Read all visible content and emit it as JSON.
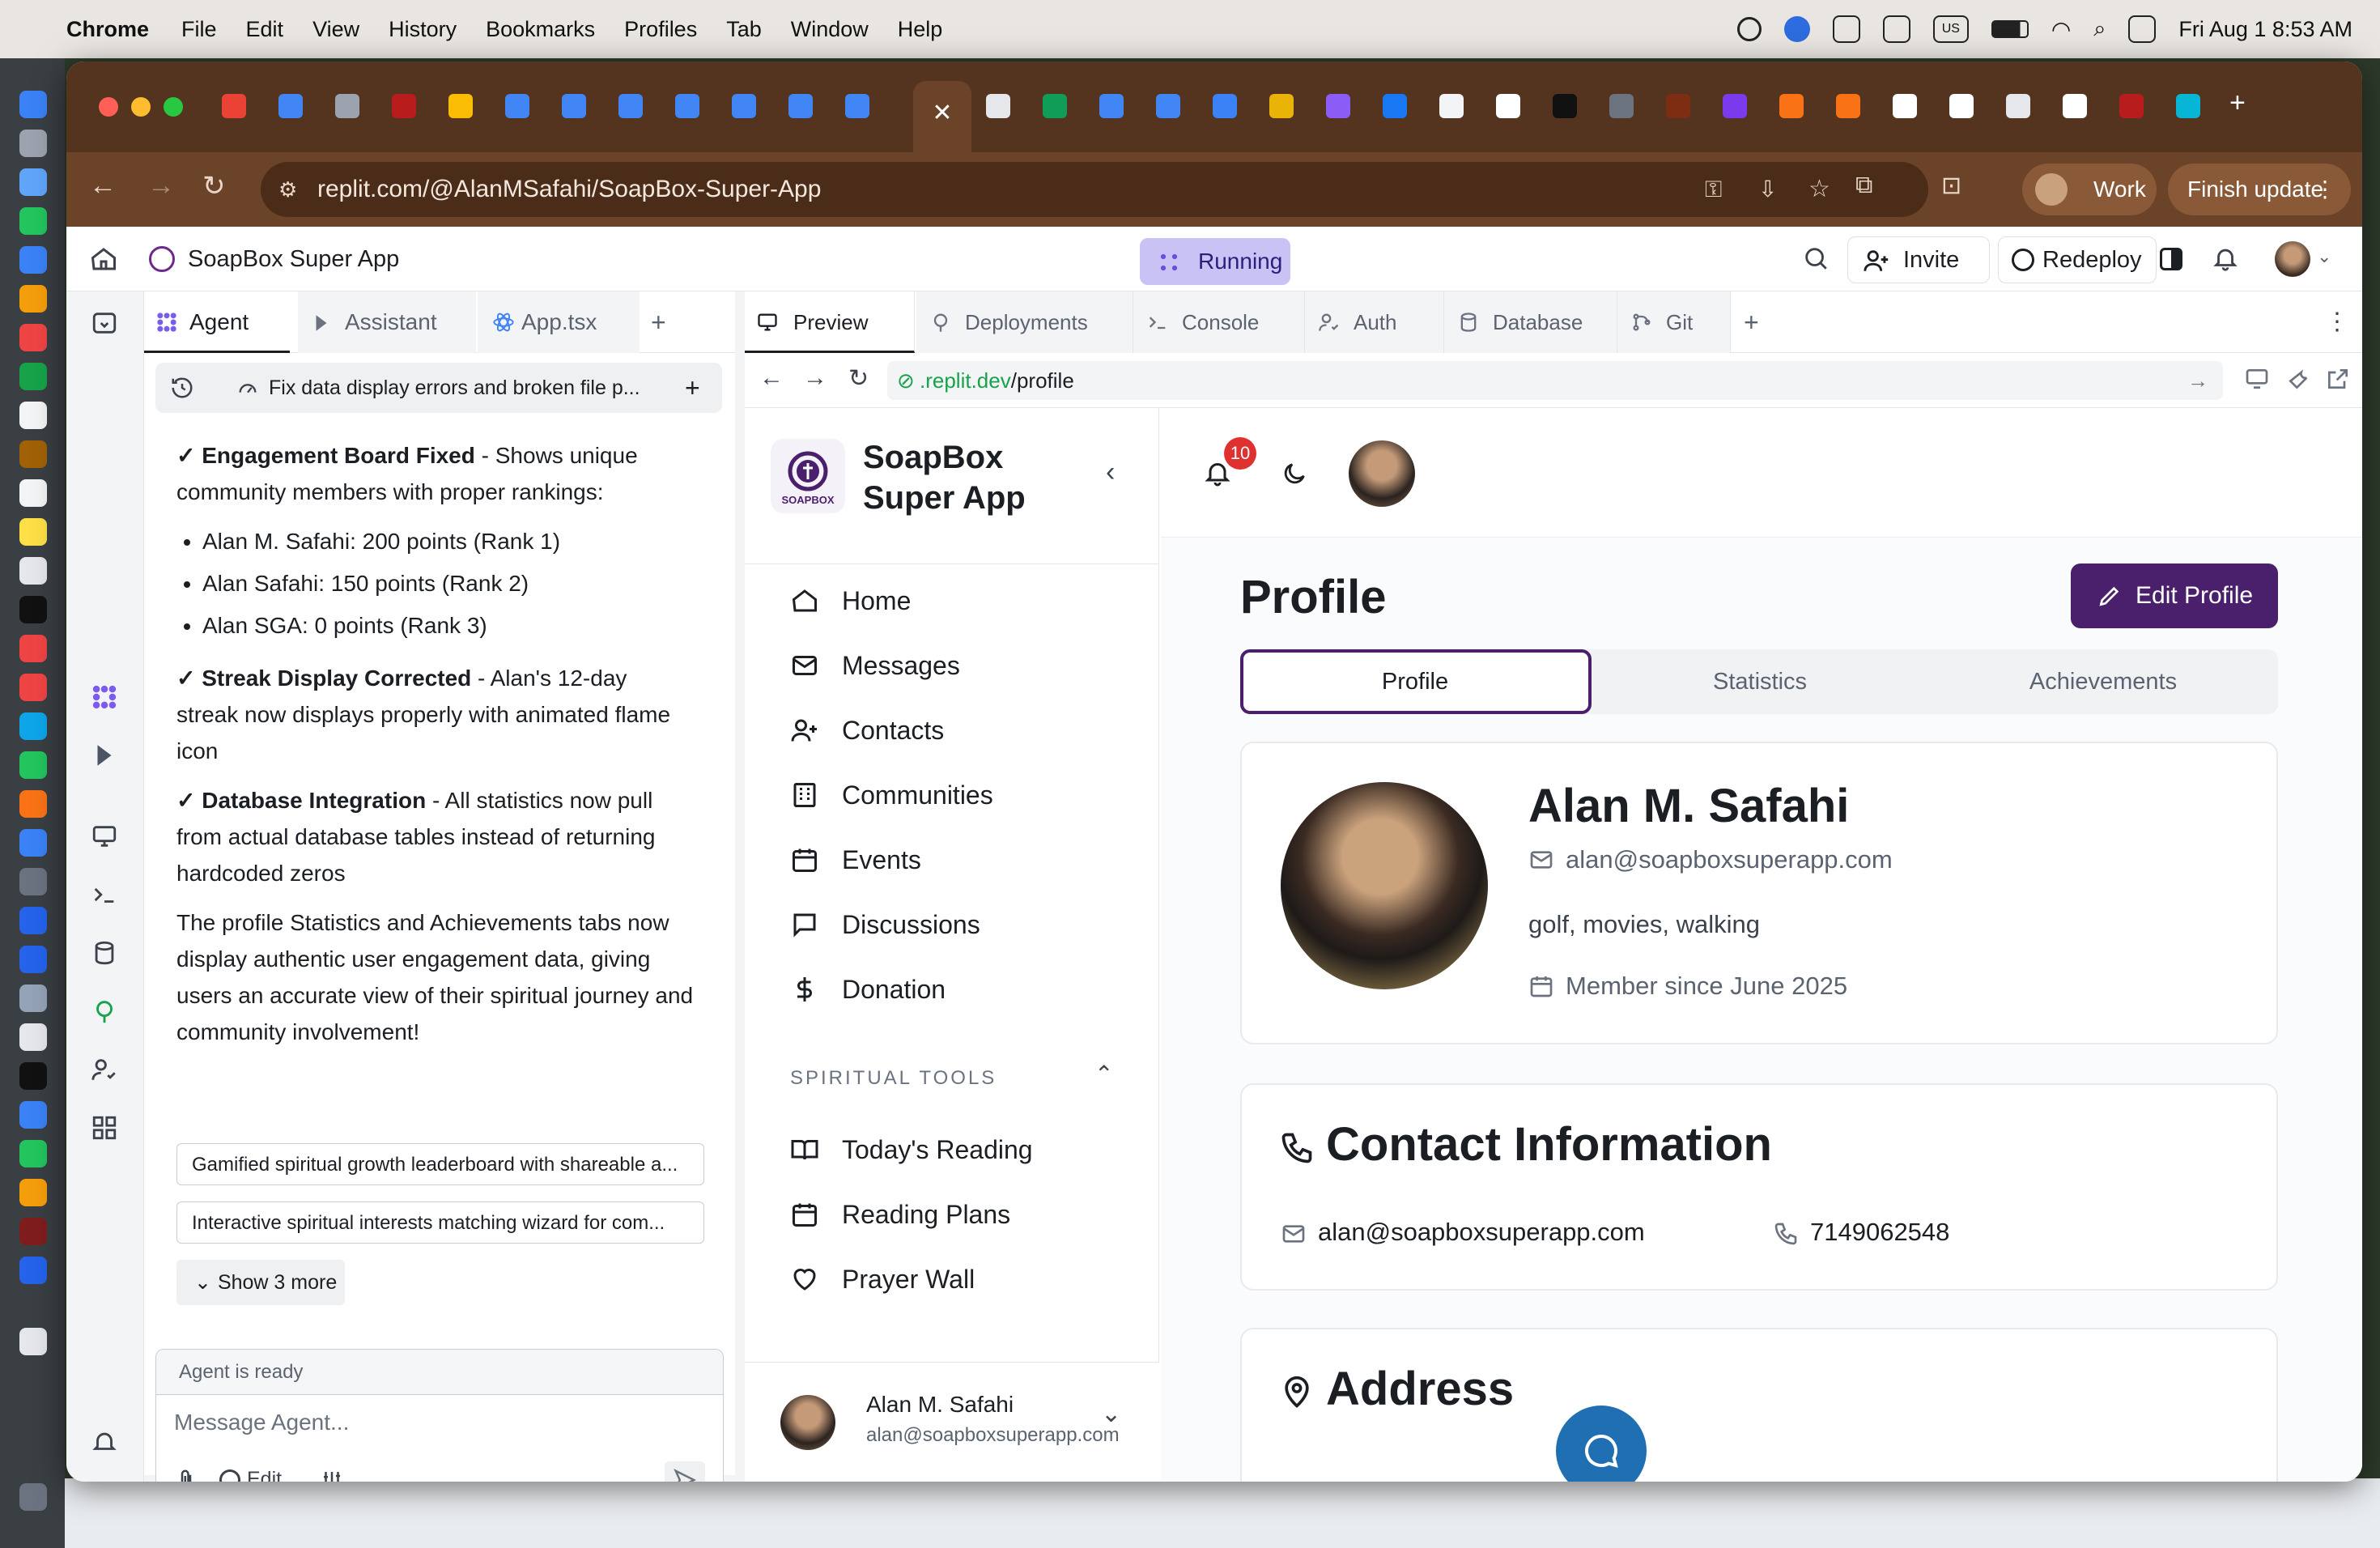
{
  "menubar": {
    "app": "Chrome",
    "items": [
      "File",
      "Edit",
      "View",
      "History",
      "Bookmarks",
      "Profiles",
      "Tab",
      "Window",
      "Help"
    ],
    "datetime": "Fri Aug 1  8:53 AM",
    "keyboard": "US"
  },
  "browser": {
    "url": "replit.com/@AlanMSafahi/SoapBox-Super-App",
    "profile_label": "Work",
    "finish_update_label": "Finish update"
  },
  "replit": {
    "app_name": "SoapBox Super App",
    "status": "Running",
    "invite_label": "Invite",
    "redeploy_label": "Redeploy",
    "agent_tabs": [
      "Agent",
      "Assistant",
      "App.tsx"
    ],
    "history_title": "Fix data display errors and broken file p...",
    "pane_tabs": [
      "Preview",
      "Deployments",
      "Console",
      "Auth",
      "Database",
      "Git"
    ],
    "preview_url_host": ".replit.dev",
    "preview_url_path": "/profile"
  },
  "agent": {
    "p1_bold": "✓ Engagement Board Fixed",
    "p1_rest": " - Shows unique community members with proper rankings:",
    "list": [
      "Alan M. Safahi: 200 points (Rank 1)",
      "Alan Safahi: 150 points (Rank 2)",
      "Alan SGA: 0 points (Rank 3)"
    ],
    "p2_bold": "✓ Streak Display Corrected",
    "p2_rest": " - Alan's 12-day streak now displays properly with animated flame icon",
    "p3_bold": "✓ Database Integration",
    "p3_rest": " - All statistics now pull from actual database tables instead of returning hardcoded zeros",
    "p4": "The profile Statistics and Achievements tabs now display authentic user engagement data, giving users an accurate view of their spiritual journey and community involvement!",
    "suggestions": [
      "Gamified spiritual growth leaderboard with shareable a...",
      "Interactive spiritual interests matching wizard for com..."
    ],
    "show_more": "Show 3 more",
    "status": "Agent is ready",
    "input_placeholder": "Message Agent...",
    "edit_label": "Edit"
  },
  "site": {
    "brand_line1": "SoapBox",
    "brand_line2": "Super App",
    "logo_text": "SOAPBOX",
    "nav": [
      "Home",
      "Messages",
      "Contacts",
      "Communities",
      "Events",
      "Discussions",
      "Donation"
    ],
    "section_label": "SPIRITUAL TOOLS",
    "tools": [
      "Today's Reading",
      "Reading Plans",
      "Prayer Wall"
    ],
    "notif_count": "10",
    "user_name": "Alan M. Safahi",
    "user_email": "alan@soapboxsuperapp.com",
    "page_title": "Profile",
    "edit_profile_label": "Edit Profile",
    "profile_tabs": [
      "Profile",
      "Statistics",
      "Achievements"
    ],
    "profile": {
      "name": "Alan M. Safahi",
      "email": "alan@soapboxsuperapp.com",
      "interests": "golf, movies, walking",
      "member_since": "Member since June 2025"
    },
    "contact": {
      "heading": "Contact Information",
      "email": "alan@soapboxsuperapp.com",
      "phone": "7149062548"
    },
    "address_heading": "Address"
  },
  "colors": {
    "brand_purple": "#4a1f6b",
    "chrome_brown": "#6b4329",
    "running_bg": "#c9c2f5",
    "fab_blue": "#1f6fb2",
    "badge_red": "#e03131"
  }
}
